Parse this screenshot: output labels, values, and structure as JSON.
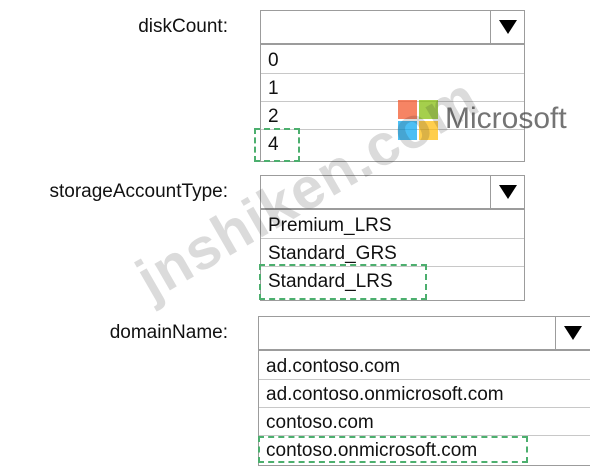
{
  "disk_count": {
    "label": "diskCount:",
    "options": [
      "0",
      "1",
      "2",
      "4"
    ]
  },
  "storage_account_type": {
    "label": "storageAccountType:",
    "options": [
      "Premium_LRS",
      "Standard_GRS",
      "Standard_LRS"
    ]
  },
  "domain_name": {
    "label": "domainName:",
    "options": [
      "ad.contoso.com",
      "ad.contoso.onmicrosoft.com",
      "contoso.com",
      "contoso.onmicrosoft.com"
    ]
  },
  "watermark": {
    "text": "jnshiken.com",
    "logo_text": "Microsoft"
  },
  "colors": {
    "highlight_dash": "#4caf6e",
    "logo_red": "#f25022",
    "logo_green": "#7fba00",
    "logo_blue": "#00a4ef",
    "logo_yellow": "#ffb900"
  }
}
